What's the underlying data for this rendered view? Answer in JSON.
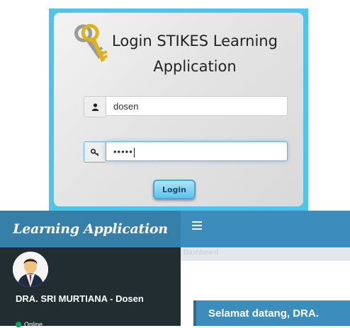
{
  "login": {
    "title": "Login STIKES Learning Application",
    "username_value": "dosen",
    "password_mask": "•••••",
    "button_label": "Login",
    "icons": {
      "username": "user-icon",
      "password": "key-icon",
      "logo": "keys-icon"
    }
  },
  "dashboard": {
    "brand": "Learning Application",
    "menu_icon": "hamburger-icon",
    "user": {
      "name": "DRA. SRI MURTIANA - Dosen",
      "status": "Online"
    },
    "content_faint": "Dashboard",
    "welcome": "Selamat datang, DRA."
  },
  "colors": {
    "login_border": "#4fc3ea",
    "topbar": "#3c8dbc",
    "brand_bg": "#367fa9",
    "sidebar": "#222d32",
    "status_online": "#00a65a"
  }
}
